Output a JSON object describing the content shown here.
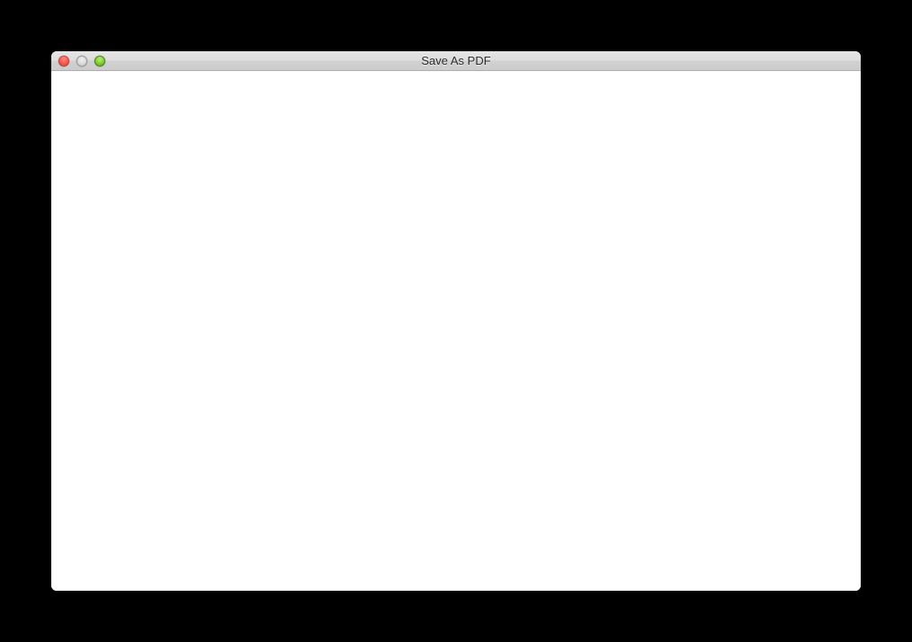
{
  "window": {
    "title": "Save As PDF"
  }
}
